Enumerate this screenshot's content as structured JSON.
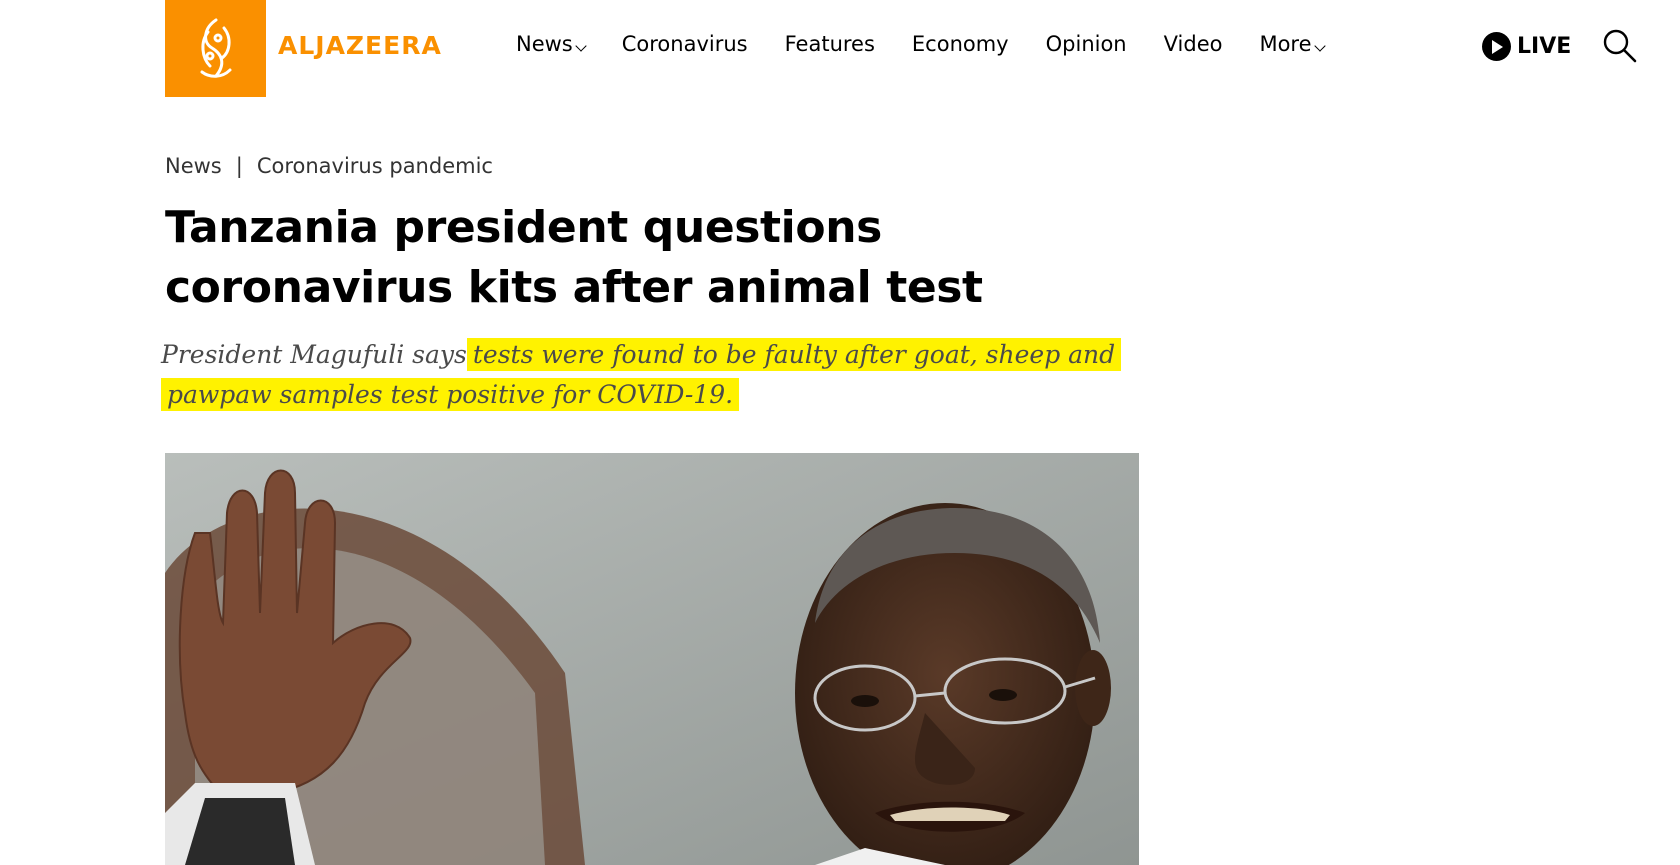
{
  "header": {
    "logo_text": "ALJAZEERA",
    "brand_color": "#fa9000",
    "nav": [
      {
        "label": "News",
        "has_dropdown": true
      },
      {
        "label": "Coronavirus",
        "has_dropdown": false
      },
      {
        "label": "Features",
        "has_dropdown": false
      },
      {
        "label": "Economy",
        "has_dropdown": false
      },
      {
        "label": "Opinion",
        "has_dropdown": false
      },
      {
        "label": "Video",
        "has_dropdown": false
      },
      {
        "label": "More",
        "has_dropdown": true
      }
    ],
    "live_label": "LIVE",
    "icons": {
      "live": "play-icon",
      "search": "search-icon"
    }
  },
  "article": {
    "breadcrumb": [
      "News",
      "Coronavirus pandemic"
    ],
    "headline": "Tanzania president questions coronavirus kits after animal test",
    "dek_plain": "President Magufuli says",
    "dek_highlight": "tests were found to be faulty after goat, sheep and pawpaw samples test positive for COVID-19.",
    "highlight_color": "#fff200"
  }
}
